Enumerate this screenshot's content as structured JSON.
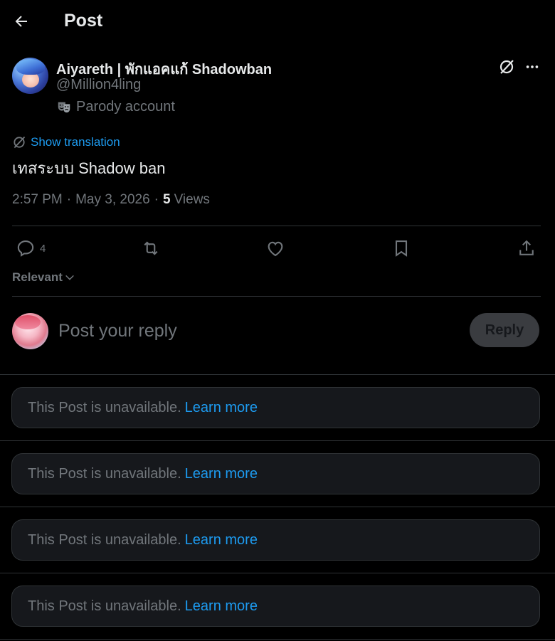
{
  "header": {
    "title": "Post"
  },
  "author": {
    "name": "Aiyareth | พักแอคแก้ Shadowban",
    "handle": "@Million4ling",
    "badge": "Parody account"
  },
  "post": {
    "show_translation": "Show translation",
    "text": "เทสระบบ Shadow ban",
    "time": "2:57 PM",
    "date": "May 3, 2026",
    "views_count": "5",
    "views_label": "Views"
  },
  "actions": {
    "reply_count": "4"
  },
  "sort": {
    "label": "Relevant"
  },
  "composer": {
    "placeholder": "Post your reply",
    "button": "Reply"
  },
  "unavailable": [
    {
      "text": "This Post is unavailable.",
      "link": "Learn more"
    },
    {
      "text": "This Post is unavailable.",
      "link": "Learn more"
    },
    {
      "text": "This Post is unavailable.",
      "link": "Learn more"
    },
    {
      "text": "This Post is unavailable.",
      "link": "Learn more"
    }
  ],
  "colors": {
    "accent": "#1d9bf0",
    "muted": "#71767b",
    "border": "#2f3336",
    "text": "#e7e9ea"
  }
}
